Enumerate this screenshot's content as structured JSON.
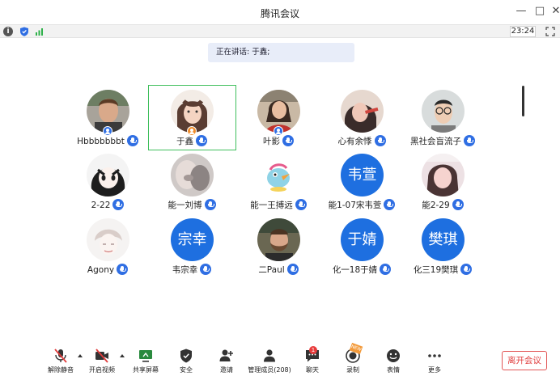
{
  "window": {
    "title": "腾讯会议"
  },
  "status": {
    "time": "23:24"
  },
  "speaking_banner": "正在讲话: 于鑫;",
  "participants": [
    {
      "name": "Hbbbbbbbt",
      "avatar": "photo-man",
      "badge": "host"
    },
    {
      "name": "于鑫",
      "avatar": "photo-girl",
      "badge": "cohost",
      "active": true
    },
    {
      "name": "叶影",
      "avatar": "photo-woman-red",
      "badge": "host"
    },
    {
      "name": "心有余悸",
      "avatar": "photo-drink",
      "badge": ""
    },
    {
      "name": "黑社会盲流子",
      "avatar": "photo-glasses",
      "badge": ""
    },
    {
      "name": "2-22",
      "avatar": "anime-girl",
      "badge": ""
    },
    {
      "name": "能一刘博",
      "avatar": "photo-blur",
      "badge": ""
    },
    {
      "name": "能一王搏远",
      "avatar": "cartoon-bird",
      "badge": ""
    },
    {
      "name": "能1-07宋韦萱",
      "avatar": "text",
      "avatar_text": "韦萱",
      "badge": ""
    },
    {
      "name": "能2-29",
      "avatar": "photo-pink",
      "badge": ""
    },
    {
      "name": "Agony",
      "avatar": "sketch",
      "badge": ""
    },
    {
      "name": "韦宗幸",
      "avatar": "text",
      "avatar_text": "宗幸",
      "badge": ""
    },
    {
      "name": "二Paul",
      "avatar": "photo-bearded",
      "badge": ""
    },
    {
      "name": "化一18于婧",
      "avatar": "text",
      "avatar_text": "于婧",
      "badge": ""
    },
    {
      "name": "化三19樊琪",
      "avatar": "text",
      "avatar_text": "樊琪",
      "badge": ""
    }
  ],
  "toolbar": {
    "mute": "解除静音",
    "video": "开启视频",
    "share": "共享屏幕",
    "security": "安全",
    "invite": "邀请",
    "members": "管理成员(208)",
    "chat": "聊天",
    "chat_badge": "1",
    "record": "录制",
    "new_tag": "NEW",
    "emoji": "表情",
    "more": "更多",
    "leave": "离开会议"
  },
  "colors": {
    "accent": "#1e6fe0",
    "active_border": "#3fbf5c",
    "leave": "#e03c3c"
  }
}
